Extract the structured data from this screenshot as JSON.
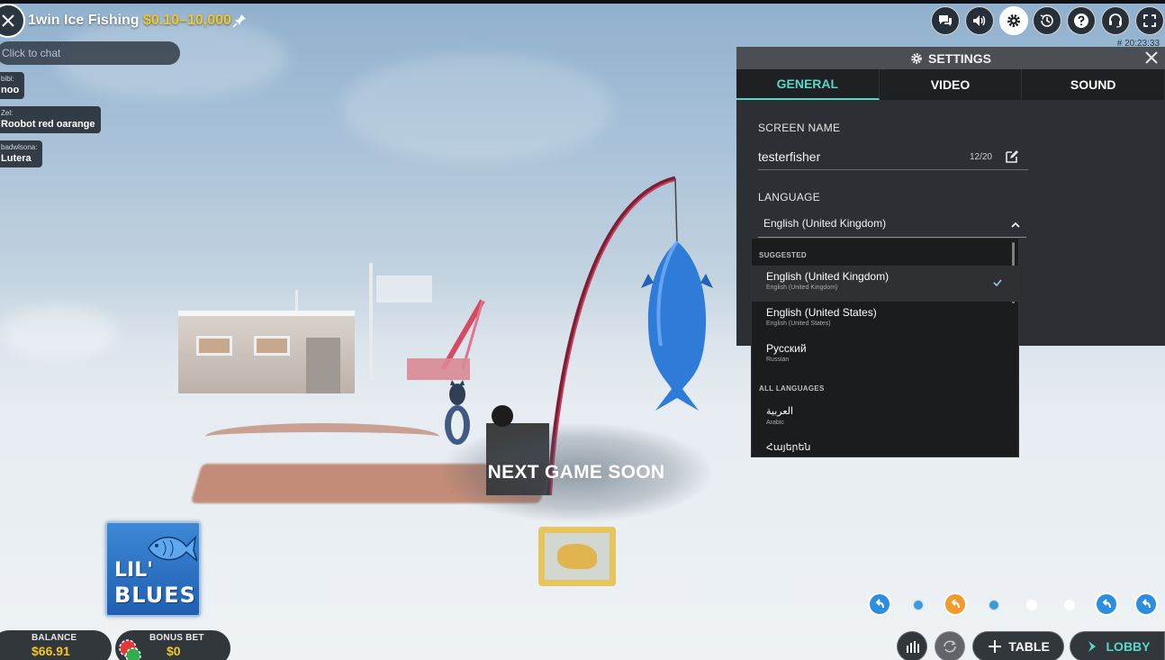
{
  "header": {
    "title": "1win Ice Fishing",
    "range": "$0.10–10,000",
    "timestamp": "# 20:23:33",
    "icons": [
      "chat-icon",
      "volume-icon",
      "gear-icon",
      "history-icon",
      "help-icon",
      "support-headset-icon",
      "fullscreen-icon"
    ]
  },
  "chat": {
    "placeholder": "Click to chat",
    "messages": [
      {
        "user": "bibi:",
        "text": "noo"
      },
      {
        "user": "Zel:",
        "text": "Roobot red oarange"
      },
      {
        "user": "badwlsona:",
        "text": "Lutera"
      }
    ]
  },
  "stage": {
    "status": "NEXT GAME SOON"
  },
  "settings": {
    "title": "SETTINGS",
    "tabs": [
      "GENERAL",
      "VIDEO",
      "SOUND"
    ],
    "active_tab": "GENERAL",
    "screen_name_label": "SCREEN NAME",
    "screen_name_value": "testerfisher",
    "screen_name_count": "12/20",
    "language_label": "LANGUAGE",
    "language_value": "English (United Kingdom)",
    "dropdown": {
      "suggested_label": "SUGGESTED",
      "suggested": [
        {
          "name": "English (United Kingdom)",
          "sub": "English (United Kingdom)",
          "selected": true
        },
        {
          "name": "English (United States)",
          "sub": "English (United States)",
          "selected": false
        },
        {
          "name": "Русский",
          "sub": "Russian",
          "selected": false
        }
      ],
      "all_label": "ALL LANGUAGES",
      "all": [
        {
          "name": "العربية",
          "sub": "Arabic"
        },
        {
          "name": "Հայերեն",
          "sub": ""
        }
      ]
    }
  },
  "promo": {
    "line1": "LIL'",
    "line2": "BLUES"
  },
  "footer": {
    "balance_label": "BALANCE",
    "balance_value": "$66.91",
    "bonus_label": "BONUS BET",
    "bonus_value": "$0",
    "table_label": "TABLE",
    "lobby_label": "LOBBY"
  },
  "colors": {
    "accent_teal": "#58d7c9",
    "money_yellow": "#f3c626",
    "nav_blue": "#2d8ee0",
    "nav_orange": "#f39a2a"
  }
}
